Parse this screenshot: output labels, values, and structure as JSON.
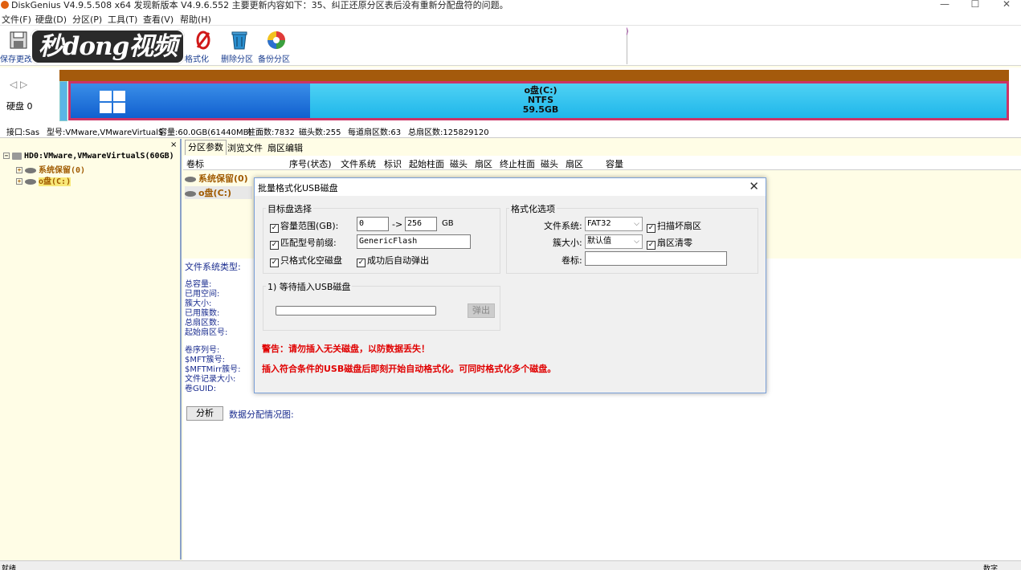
{
  "window": {
    "title": "DiskGenius V4.9.5.508 x64    发现新版本 V4.9.6.552 主要更新内容如下：35、纠正还原分区表后没有重新分配盘符的问题。",
    "minimize": "—",
    "maximize": "☐",
    "close": "✕"
  },
  "menu": [
    "文件(F)",
    "硬盘(D)",
    "分区(P)",
    "工具(T)",
    "查看(V)",
    "帮助(H)"
  ],
  "toolbar": {
    "save_label": "保存更改",
    "format_label": "格式化",
    "delete_label": "删除分区",
    "backup_label": "备份分区",
    "watermark": "秒dong视频"
  },
  "disk": {
    "nav": "◁ ▷",
    "label": "硬盘 0",
    "partition_name": "o盘(C:)",
    "partition_fs": "NTFS",
    "partition_size": "59.5GB"
  },
  "infobar": {
    "interface": "接口:Sas",
    "model": "型号:VMware,VMwareVirtualS",
    "capacity": "容量:60.0GB(61440MB)",
    "cylinders": "柱面数:7832",
    "heads": "磁头数:255",
    "sectors_per_track": "每道扇区数:63",
    "total_sectors": "总扇区数:125829120"
  },
  "tree": {
    "close": "×",
    "root": "HD0:VMware,VMwareVirtualS(60GB)",
    "items": [
      "系统保留(0)",
      "o盘(C:)"
    ]
  },
  "tabs": [
    "分区参数",
    "浏览文件",
    "扇区编辑"
  ],
  "columns": [
    "卷标",
    "序号(状态)",
    "文件系统",
    "标识",
    "起始柱面",
    "磁头",
    "扇区",
    "终止柱面",
    "磁头",
    "扇区",
    "容量"
  ],
  "partition_rows": [
    "系统保留(0)",
    "o盘(C:)"
  ],
  "details": {
    "fs_type": "文件系统类型:",
    "group1": [
      "总容量:",
      "已用空间:",
      "簇大小:",
      "已用簇数:",
      "总扇区数:",
      "起始扇区号:"
    ],
    "group2": [
      "卷序列号:",
      "$MFT簇号:",
      "$MFTMirr簇号:",
      "文件记录大小:",
      "卷GUID:"
    ],
    "analyze_button": "分析",
    "distribution_label": "数据分配情况图:"
  },
  "status": {
    "left": "就绪",
    "right": "数字"
  },
  "dialog": {
    "title": "批量格式化USB磁盘",
    "close": "✕",
    "target_group": "目标盘选择",
    "capacity_range_label": "容量范围(GB):",
    "capacity_from": "0",
    "capacity_arrow": "->",
    "capacity_to": "256",
    "capacity_unit": "GB",
    "model_prefix_label": "匹配型号前缀:",
    "model_prefix": "GenericFlash",
    "only_empty_label": "只格式化空磁盘",
    "auto_eject_label": "成功后自动弹出",
    "format_group": "格式化选项",
    "fs_label": "文件系统:",
    "fs_value": "FAT32",
    "scan_bad_label": "扫描坏扇区",
    "cluster_label": "簇大小:",
    "cluster_value": "默认值",
    "zero_sector_label": "扇区清零",
    "volume_label": "卷标:",
    "volume_value": "",
    "wait_group": "1) 等待插入USB磁盘",
    "eject_button": "弹出",
    "warning": "警告：请勿插入无关磁盘，以防数据丢失！",
    "info": "插入符合条件的USB磁盘后即刻开始自动格式化。可同时格式化多个磁盘。"
  }
}
